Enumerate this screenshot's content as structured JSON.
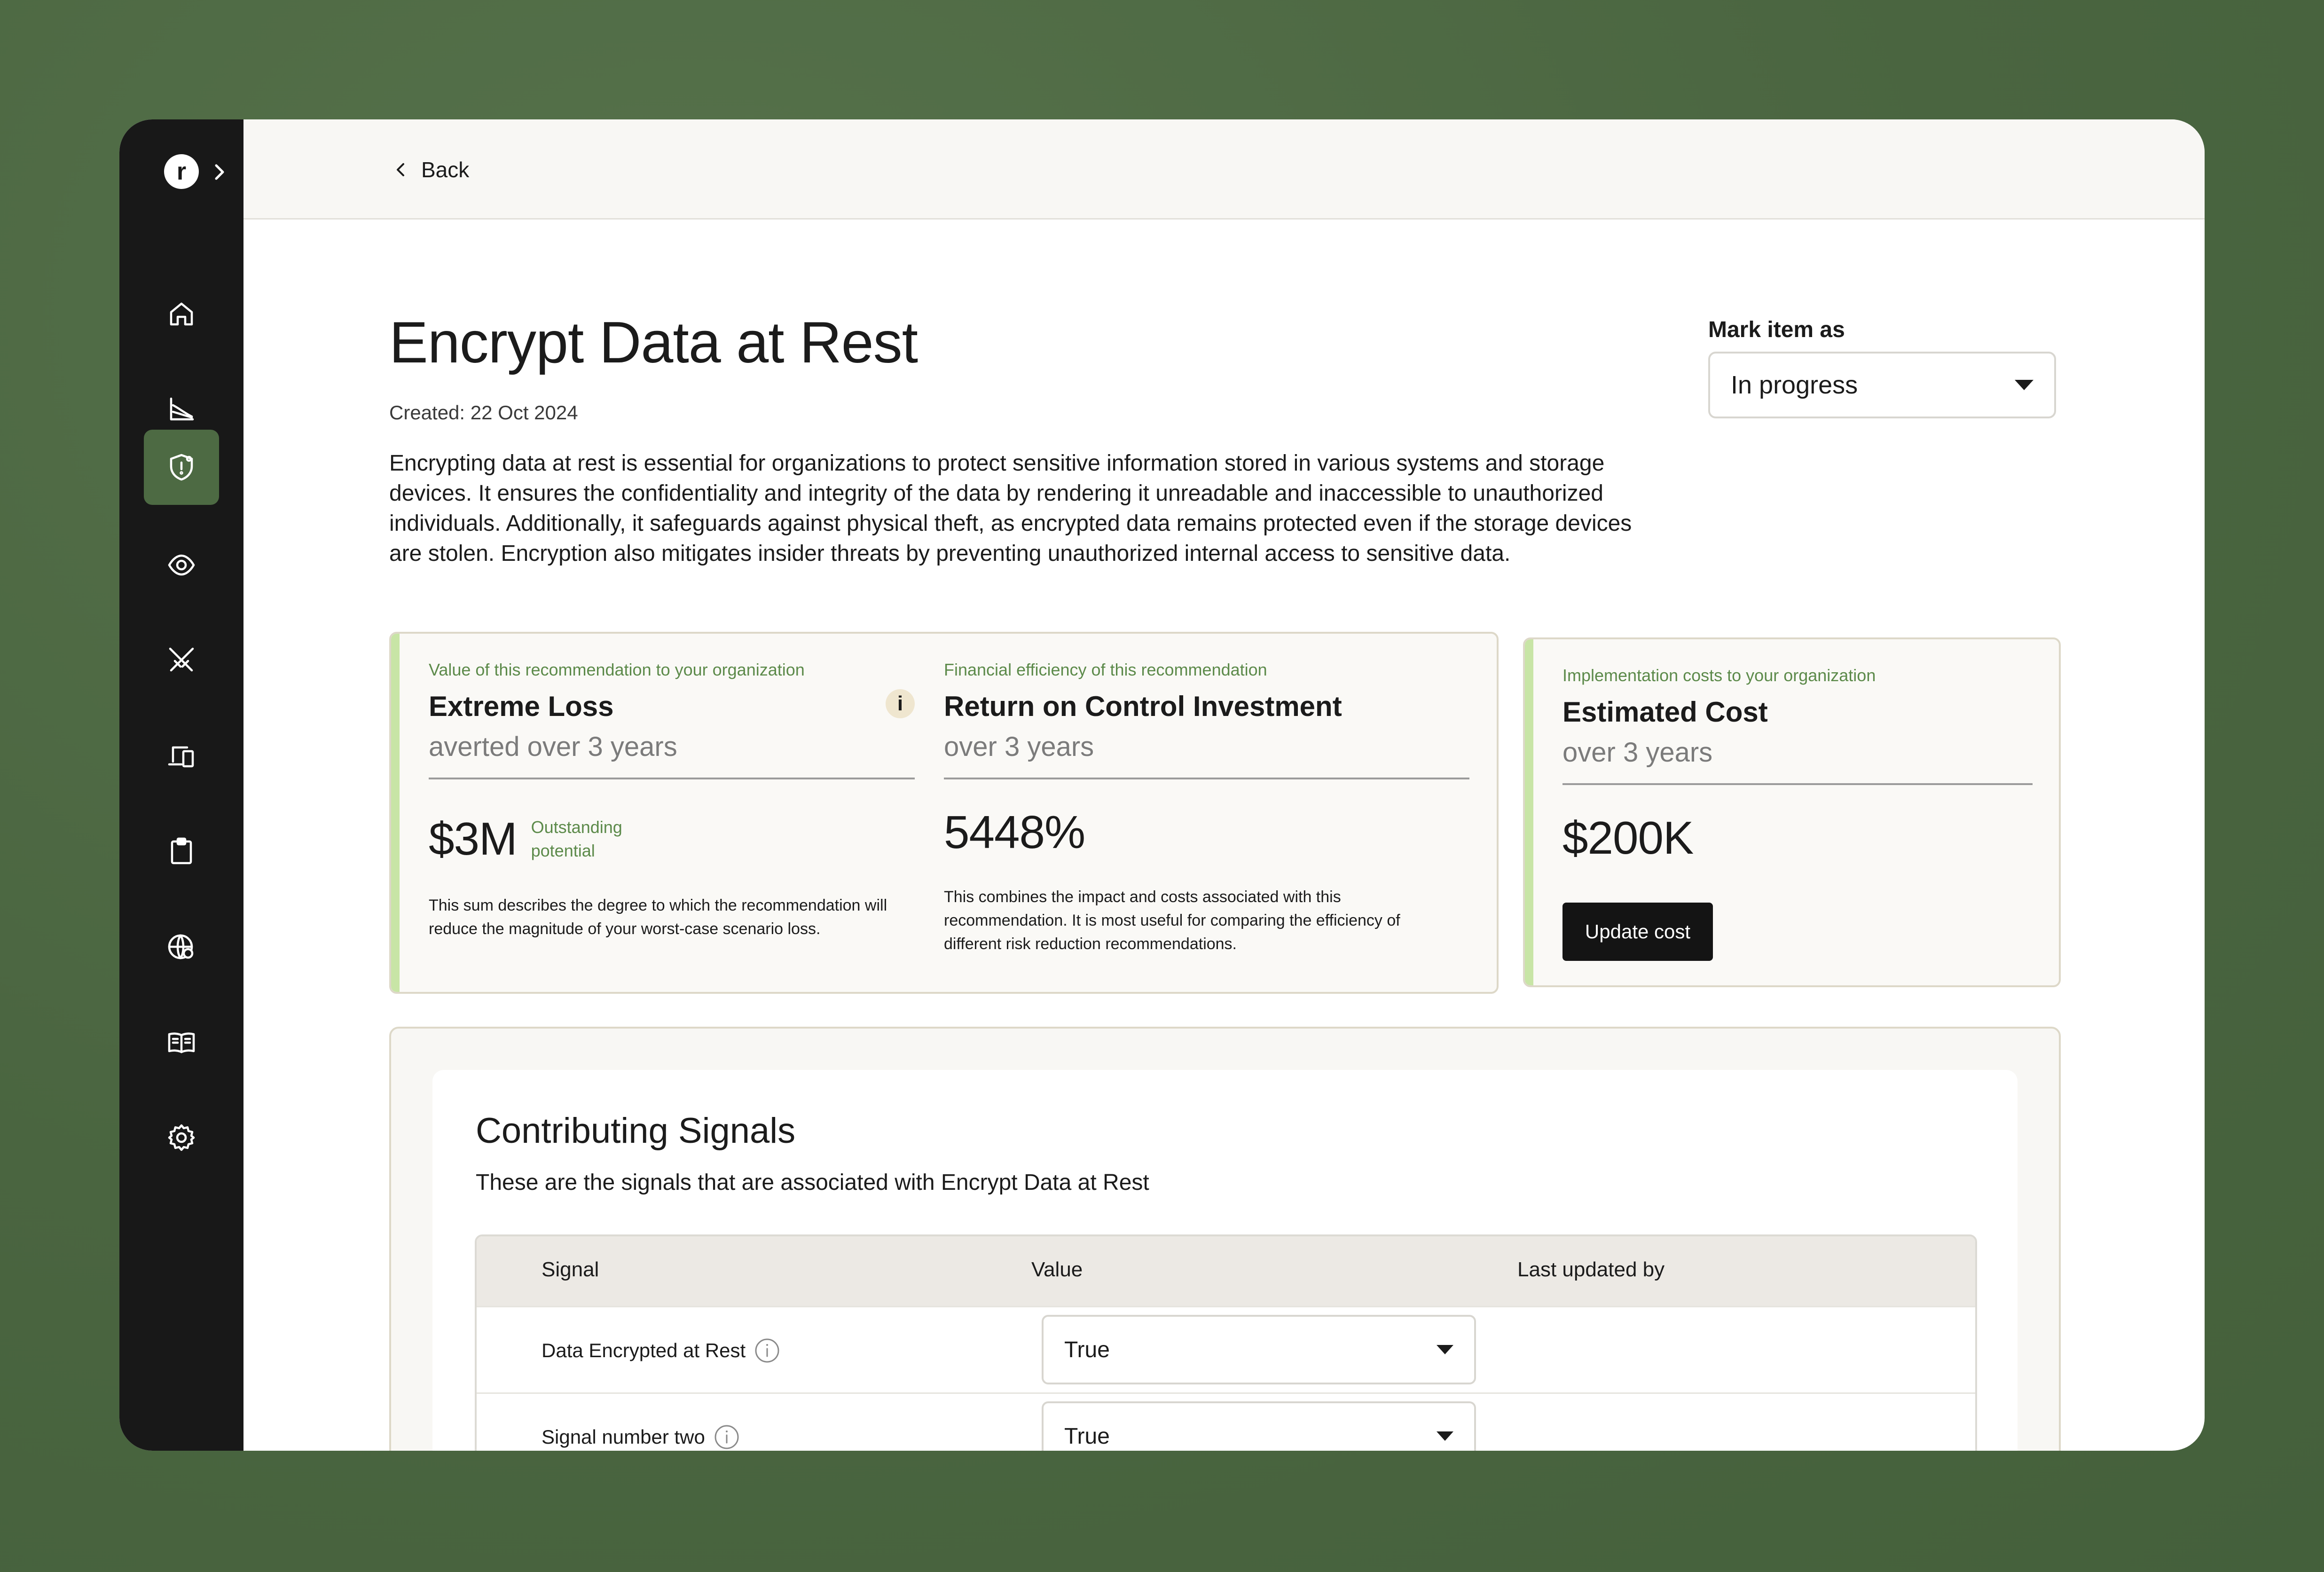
{
  "nav": {
    "back_label": "Back",
    "items": [
      {
        "icon": "home-icon",
        "active": false
      },
      {
        "icon": "chart-icon",
        "active": false
      },
      {
        "icon": "shield-icon",
        "active": true
      },
      {
        "icon": "eye-icon",
        "active": false
      },
      {
        "icon": "swords-icon",
        "active": false
      },
      {
        "icon": "devices-icon",
        "active": false
      },
      {
        "icon": "clipboard-icon",
        "active": false
      },
      {
        "icon": "globe-icon",
        "active": false
      },
      {
        "icon": "book-icon",
        "active": false
      },
      {
        "icon": "gear-icon",
        "active": false
      }
    ]
  },
  "logo": {
    "letter": "r"
  },
  "header": {
    "title": "Encrypt Data at Rest",
    "created": "Created: 22 Oct 2024",
    "description": "Encrypting data at rest is essential for organizations to protect sensitive information stored in various systems and storage devices. It ensures the confidentiality and integrity of the data by rendering it unreadable and inaccessible to unauthorized individuals. Additionally, it safeguards against physical theft, as encrypted data remains protected even if the storage devices are stolen. Encryption also mitigates insider threats by preventing unauthorized internal access to sensitive data.",
    "mark_label": "Mark item as",
    "mark_value": "In progress"
  },
  "cards": {
    "loss": {
      "kicker": "Value of this recommendation to your organization",
      "title": "Extreme Loss",
      "subtitle": "averted over 3 years",
      "value": "$3M",
      "badge": "Outstanding potential",
      "info": "i",
      "note": "This sum describes the degree to which the recommendation will reduce the magnitude of your worst-case scenario loss."
    },
    "roi": {
      "kicker": "Financial efficiency of this recommendation",
      "title": "Return on Control Investment",
      "subtitle": "over 3 years",
      "value": "5448%",
      "note": "This combines the impact and costs associated with this recommendation. It is most useful for comparing the efficiency of different risk reduction recommendations."
    },
    "cost": {
      "kicker": "Implementation costs to your organization",
      "title": "Estimated Cost",
      "subtitle": "over 3 years",
      "value": "$200K",
      "button": "Update cost"
    }
  },
  "signals": {
    "title": "Contributing Signals",
    "subtitle": "These are the signals that are associated with Encrypt Data at Rest",
    "columns": [
      "Signal",
      "Value",
      "Last updated by"
    ],
    "rows": [
      {
        "name": "Data Encrypted at Rest",
        "value": "True",
        "updated_by": ""
      },
      {
        "name": "Signal number two",
        "value": "True",
        "updated_by": ""
      }
    ]
  },
  "colors": {
    "background": "#4d6a43",
    "sidebar": "#181818",
    "active_nav": "#4d6a43",
    "accent_green_text": "#5c8a4a",
    "card_accent": "#c8e5a6"
  }
}
